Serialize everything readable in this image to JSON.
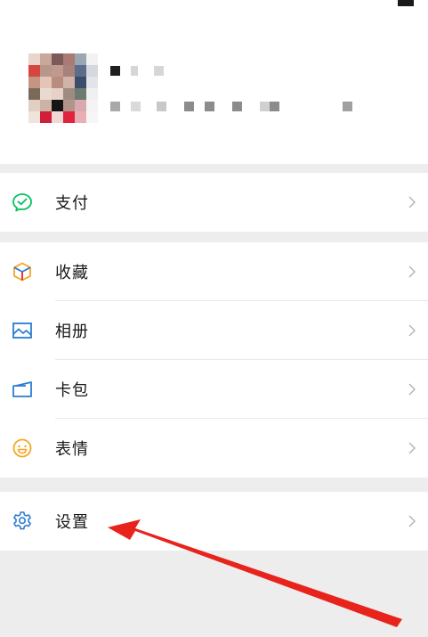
{
  "menu": {
    "pay": {
      "label": "支付",
      "icon": "wechat-pay-icon"
    },
    "favorites": {
      "label": "收藏",
      "icon": "cube-icon"
    },
    "album": {
      "label": "相册",
      "icon": "image-icon"
    },
    "cards": {
      "label": "卡包",
      "icon": "card-icon"
    },
    "stickers": {
      "label": "表情",
      "icon": "smiley-icon"
    },
    "settings": {
      "label": "设置",
      "icon": "gear-icon"
    }
  },
  "colors": {
    "green": "#07c160",
    "orange_yellow": "#f5a623",
    "blue": "#2b7cd3",
    "arrow_red": "#e8231b",
    "chevron": "#b2b2b2",
    "background": "#ededed"
  },
  "annotation": {
    "type": "red-arrow",
    "points_to": "settings"
  }
}
